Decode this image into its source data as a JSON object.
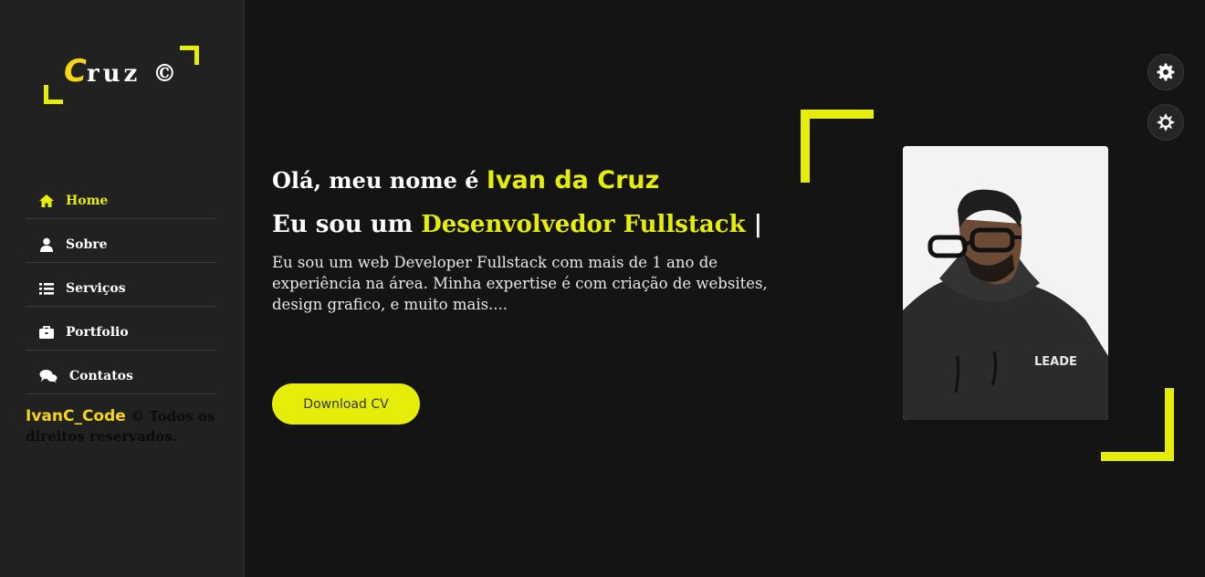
{
  "logo": {
    "initial": "C",
    "rest": "ruz ©"
  },
  "nav": {
    "items": [
      {
        "label": "Home",
        "icon": "home-icon",
        "active": true
      },
      {
        "label": "Sobre",
        "icon": "user-icon"
      },
      {
        "label": "Serviços",
        "icon": "list-icon"
      },
      {
        "label": "Portfolio",
        "icon": "briefcase-icon"
      },
      {
        "label": "Contatos",
        "icon": "chat-icon"
      }
    ]
  },
  "footer": {
    "brand": "IvanC_Code",
    "text": " © Todos os direitos reservados."
  },
  "hero": {
    "greeting": "Olá, meu nome é ",
    "name": "Ivan da Cruz",
    "role_prefix": "Eu sou um ",
    "role": "Desenvolvedor Fullstack",
    "cursor": " |",
    "description": "Eu sou um web Developer Fullstack com mais de 1 ano de experiência na área. Minha expertise é com criação de websites, design grafico, e muito mais....",
    "cv_button": "Download CV"
  },
  "photo": {
    "shirt_text": "LEADE"
  },
  "controls": {
    "settings_icon": "gear-icon",
    "theme_icon": "sun-icon"
  },
  "colors": {
    "accent": "#e6ed08",
    "logo_yellow": "#f5d515",
    "background": "#141414",
    "sidebar": "#212121"
  }
}
